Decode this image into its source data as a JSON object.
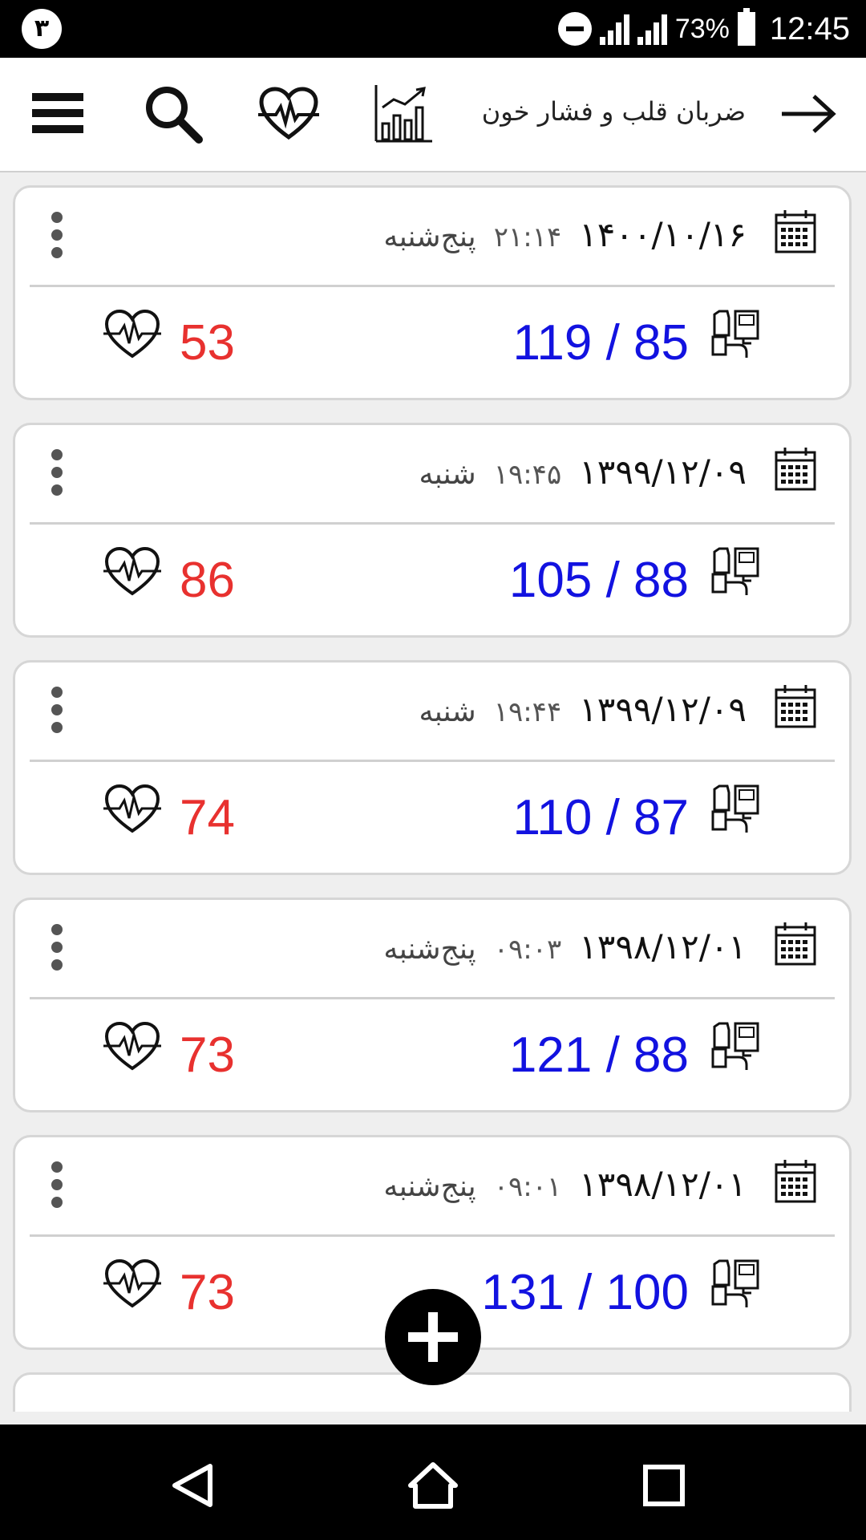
{
  "status_bar": {
    "notification_badge": "۳",
    "battery_percent": "73%",
    "clock": "12:45",
    "icons": [
      "do-not-disturb-icon",
      "signal-no-data-icon",
      "signal-icon",
      "battery-icon"
    ]
  },
  "app_bar": {
    "title": "ضربان قلب و فشار خون",
    "icons": [
      "back-arrow-icon",
      "chart-icon",
      "heartbeat-icon",
      "search-icon",
      "menu-icon"
    ]
  },
  "records": [
    {
      "date": "۱۴۰۰/۱۰/۱۶",
      "time": "۲۱:۱۴",
      "day": "پنج‌شنبه",
      "blood_pressure": "119 / 85",
      "pulse": "53"
    },
    {
      "date": "۱۳۹۹/۱۲/۰۹",
      "time": "۱۹:۴۵",
      "day": "شنبه",
      "blood_pressure": "105 / 88",
      "pulse": "86"
    },
    {
      "date": "۱۳۹۹/۱۲/۰۹",
      "time": "۱۹:۴۴",
      "day": "شنبه",
      "blood_pressure": "110 / 87",
      "pulse": "74"
    },
    {
      "date": "۱۳۹۸/۱۲/۰۱",
      "time": "۰۹:۰۳",
      "day": "پنج‌شنبه",
      "blood_pressure": "121 / 88",
      "pulse": "73"
    },
    {
      "date": "۱۳۹۸/۱۲/۰۱",
      "time": "۰۹:۰۱",
      "day": "پنج‌شنبه",
      "blood_pressure": "131 / 100",
      "pulse": "73"
    }
  ],
  "colors": {
    "systolic_diastolic": "#1212e0",
    "pulse": "#e8312f"
  },
  "fab": {
    "icon": "plus-icon"
  },
  "nav_bar": {
    "icons": [
      "back-triangle-icon",
      "home-icon",
      "recents-icon"
    ]
  }
}
